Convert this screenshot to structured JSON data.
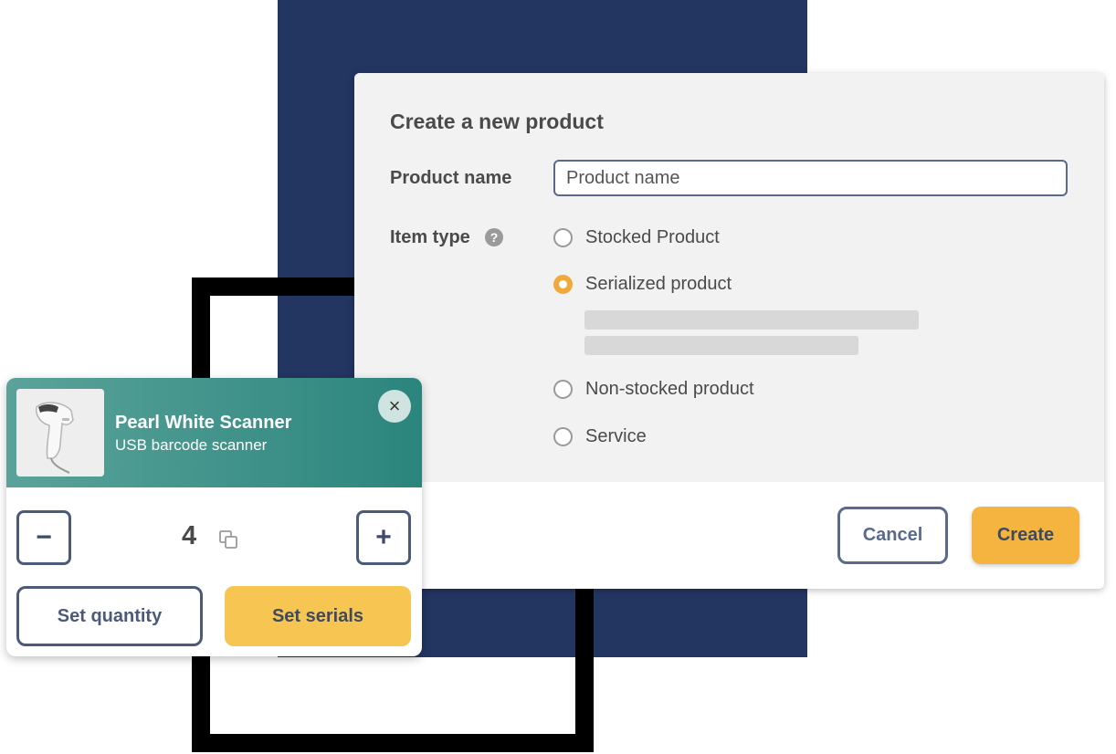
{
  "dialog": {
    "title": "Create a new product",
    "product_name_label": "Product name",
    "product_name_placeholder": "Product name",
    "product_name_value": "",
    "item_type_label": "Item type",
    "help_icon": "help-icon",
    "item_types": [
      {
        "label": "Stocked Product",
        "selected": false
      },
      {
        "label": "Serialized product",
        "selected": true
      },
      {
        "label": "Non-stocked product",
        "selected": false
      },
      {
        "label": "Service",
        "selected": false
      }
    ],
    "cancel_label": "Cancel",
    "create_label": "Create"
  },
  "product_card": {
    "product_title": "Pearl White Scanner",
    "product_subtitle": "USB barcode scanner",
    "close_icon": "close-icon",
    "decrement_label": "−",
    "increment_label": "+",
    "quantity": "4",
    "copy_icon": "copy-icon",
    "set_quantity_label": "Set quantity",
    "set_serials_label": "Set serials"
  },
  "colors": {
    "navy_background": "#233561",
    "accent_orange": "#f4b43f",
    "radio_selected": "#f0a93b",
    "header_teal": "#2b857d",
    "button_outline": "#5a6a8c",
    "serials_yellow": "#f6c552"
  }
}
